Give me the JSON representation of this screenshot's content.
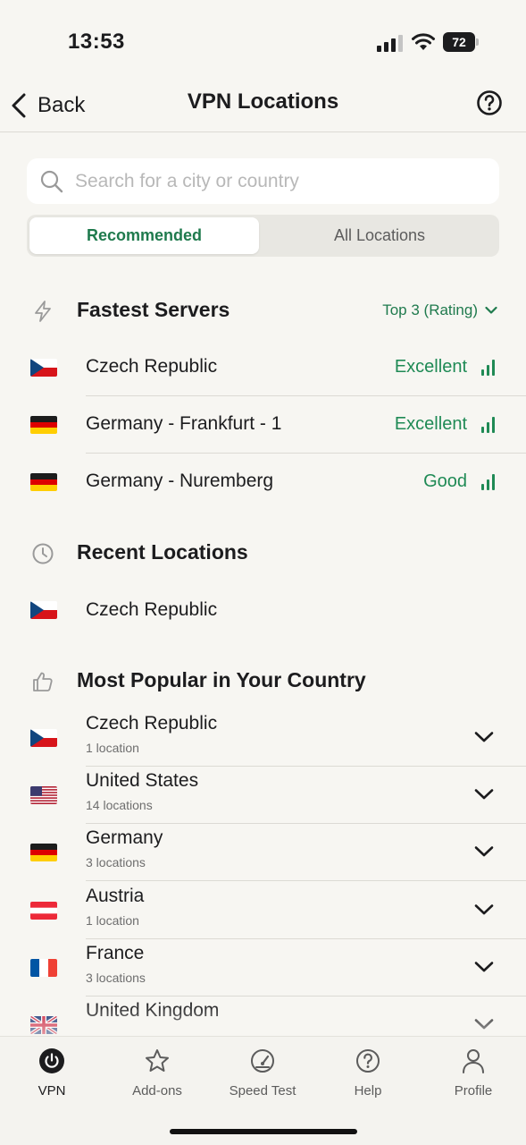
{
  "status_bar": {
    "time": "13:53",
    "battery": "72"
  },
  "nav": {
    "back_label": "Back",
    "title": "VPN Locations",
    "help_icon": "question-circle-icon"
  },
  "search": {
    "placeholder": "Search for a city or country"
  },
  "tabs": {
    "active": "Recommended",
    "inactive": "All Locations"
  },
  "fastest": {
    "title": "Fastest Servers",
    "sort_label": "Top 3 (Rating)",
    "servers": [
      {
        "name": "Czech Republic",
        "rating": "Excellent",
        "flag": "cz"
      },
      {
        "name": "Germany - Frankfurt - 1",
        "rating": "Excellent",
        "flag": "de"
      },
      {
        "name": "Germany - Nuremberg",
        "rating": "Good",
        "flag": "de"
      }
    ]
  },
  "recent": {
    "title": "Recent Locations",
    "items": [
      {
        "name": "Czech Republic",
        "flag": "cz"
      }
    ]
  },
  "popular": {
    "title": "Most Popular in Your Country",
    "items": [
      {
        "name": "Czech Republic",
        "count": "1 location",
        "flag": "cz"
      },
      {
        "name": "United States",
        "count": "14 locations",
        "flag": "us"
      },
      {
        "name": "Germany",
        "count": "3 locations",
        "flag": "de"
      },
      {
        "name": "Austria",
        "count": "1 location",
        "flag": "at"
      },
      {
        "name": "France",
        "count": "3 locations",
        "flag": "fr"
      },
      {
        "name": "United Kingdom",
        "count": "",
        "flag": "gb"
      }
    ]
  },
  "tab_bar": {
    "items": [
      {
        "label": "VPN",
        "icon": "power-icon"
      },
      {
        "label": "Add-ons",
        "icon": "star-icon"
      },
      {
        "label": "Speed Test",
        "icon": "speedometer-icon"
      },
      {
        "label": "Help",
        "icon": "question-circle-icon"
      },
      {
        "label": "Profile",
        "icon": "person-icon"
      }
    ]
  },
  "colors": {
    "accent": "#1f7a4d",
    "rating": "#1f8a55",
    "background": "#f7f6f2"
  }
}
